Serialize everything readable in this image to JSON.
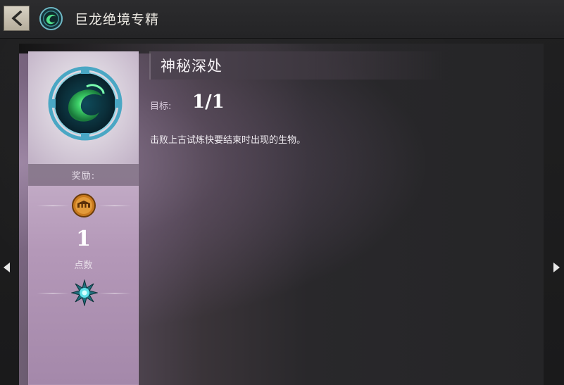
{
  "header": {
    "back_icon": "chevron-left-icon",
    "category_icon": "dragon-mastery-icon",
    "title": "巨龙绝境专精"
  },
  "reward": {
    "achievement_icon": "achievement-emblem-icon",
    "label": "奖励:",
    "mastery_icon": "mastery-coin-icon",
    "points_value": "1",
    "points_label": "点数",
    "region_icon": "region-star-icon"
  },
  "details": {
    "title": "神秘深处",
    "goal_label": "目标:",
    "goal_value": "1/1",
    "description": "击败上古试炼快要结束时出现的生物。"
  },
  "nav": {
    "prev_icon": "arrow-left-icon",
    "next_icon": "arrow-right-icon"
  },
  "colors": {
    "panel_accent": "#c4aec8",
    "header_bg": "#2c2c2e",
    "emblem_green": "#3fd46a",
    "emblem_ring": "#4aa7c4",
    "coin_orange": "#c97a1e"
  }
}
